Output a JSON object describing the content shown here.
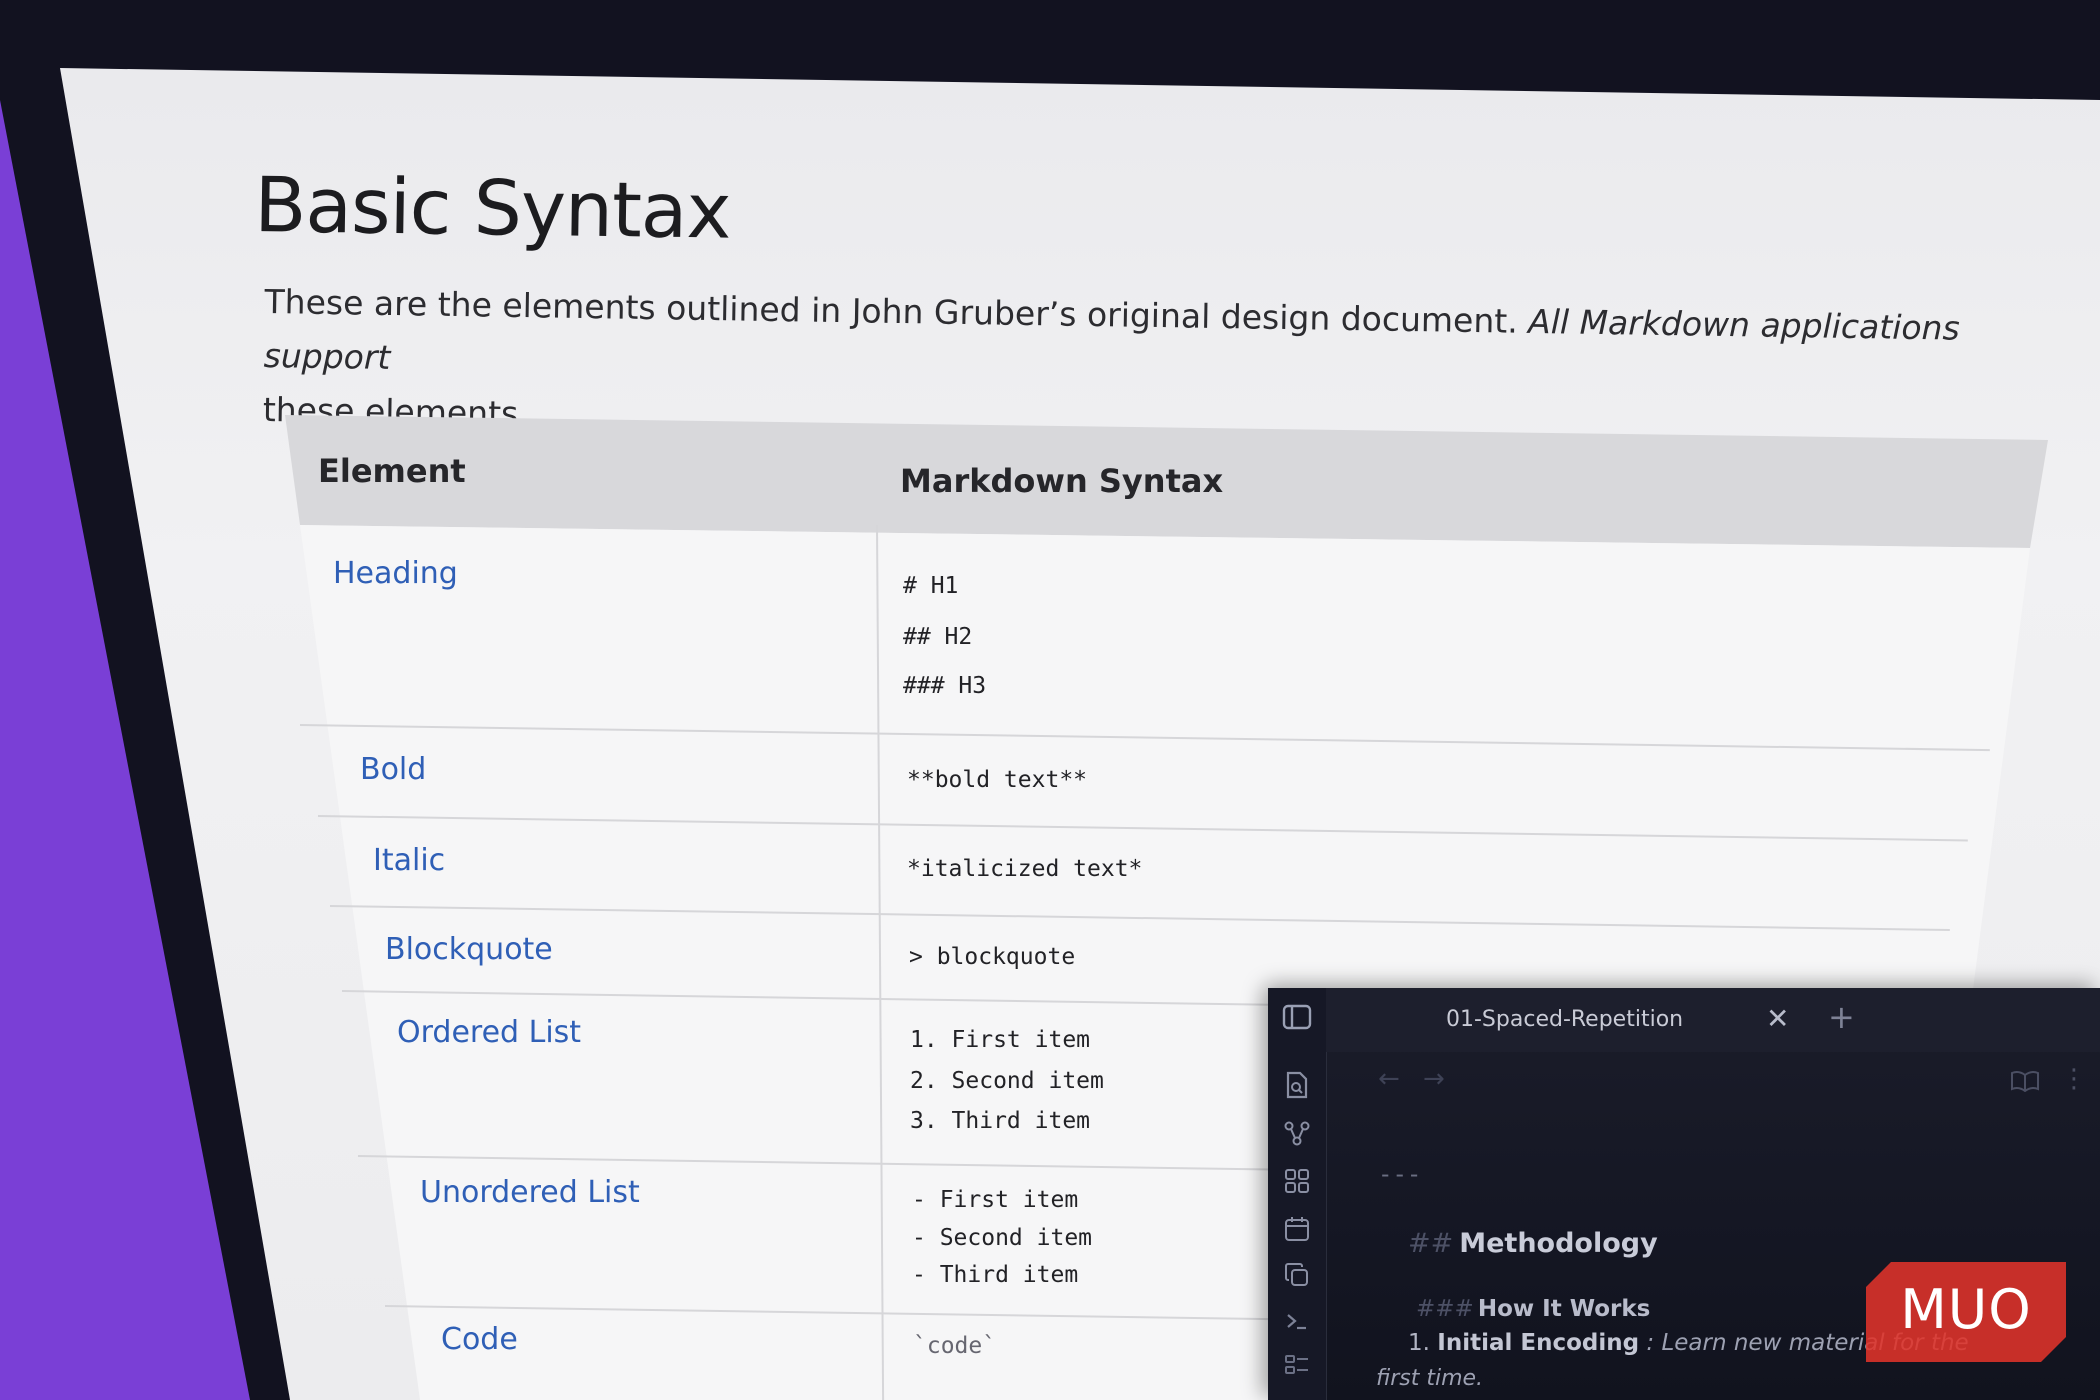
{
  "page": {
    "title": "Basic Syntax",
    "intro": {
      "normal": "These are the elements outlined in John Gruber’s original design document. ",
      "italic": "All Markdown applications support",
      "line2": "these elements."
    }
  },
  "table": {
    "headers": {
      "element": "Element",
      "syntax": "Markdown Syntax"
    },
    "rows": [
      {
        "element": "Heading",
        "syntax": [
          "# H1",
          "## H2",
          "### H3"
        ]
      },
      {
        "element": "Bold",
        "syntax": [
          "**bold text**"
        ]
      },
      {
        "element": "Italic",
        "syntax": [
          "*italicized text*"
        ]
      },
      {
        "element": "Blockquote",
        "syntax": [
          "> blockquote"
        ]
      },
      {
        "element": "Ordered List",
        "syntax": [
          "1. First item",
          "2. Second item",
          "3. Third item"
        ]
      },
      {
        "element": "Unordered List",
        "syntax": [
          "- First item",
          "- Second item",
          "- Third item"
        ]
      },
      {
        "element": "Code",
        "syntax": [
          "`code`"
        ]
      }
    ]
  },
  "editor": {
    "tab_title": "01-Spaced-Repetition",
    "tab_close": "✕",
    "tab_new": "+",
    "nav_back": "←",
    "nav_forward": "→",
    "more": "⋮",
    "hr_markup": "---",
    "h2_marker": "##",
    "h2_text": "Methodology",
    "h3_marker": "###",
    "h3_text": "How It Works",
    "list_number": "1.",
    "list_bold": "Initial Encoding",
    "list_rest": ": Learn new material for the",
    "list_rest_line2": "first time.",
    "sidebar_icons": [
      "sidebar-toggle-icon",
      "file-search-icon",
      "graph-icon",
      "grid-icon",
      "calendar-icon",
      "copy-icon",
      "terminal-icon",
      "list-icon"
    ]
  },
  "watermark": {
    "text": "MUO",
    "color": "#e0332a"
  }
}
